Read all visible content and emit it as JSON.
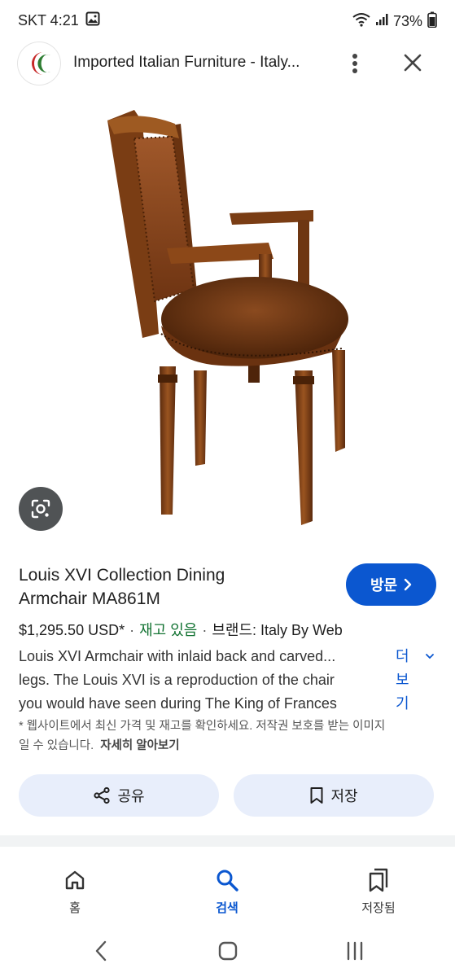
{
  "status_bar": {
    "carrier_time": "SKT 4:21",
    "battery": "73%"
  },
  "header": {
    "title": "Imported Italian Furniture - Italy...",
    "logo_colors": [
      "#c62828",
      "#2e7d32"
    ]
  },
  "product": {
    "title_line1": "Louis XVI Collection Dining",
    "title_line2": "Armchair MA861M",
    "visit_label": "방문",
    "price": "$1,295.50 USD*",
    "stock": "재고 있음",
    "brand": "브랜드: Italy By Web",
    "desc_line1": "Louis XVI Armchair with inlaid back and carved...",
    "desc_line2": "legs. The Louis XVI is a reproduction of the chair",
    "desc_line3": "you would have seen during The King of Frances",
    "more_label_1": "더",
    "more_label_2": "보",
    "more_label_3": "기",
    "disclaimer_line1": "* 웹사이트에서 최신 가격 및 재고를 확인하세요. 저작권 보호를 받는 이미지",
    "disclaimer_line2": "일 수 있습니다.",
    "learn_more": "자세히 알아보기"
  },
  "actions": {
    "share_label": "공유",
    "save_label": "저장"
  },
  "bottom_nav": {
    "home_label": "홈",
    "search_label": "검색",
    "saved_label": "저장됨"
  },
  "colors": {
    "accent": "#0b57d0",
    "stock_green": "#137333",
    "action_bg": "#e8eefb"
  }
}
